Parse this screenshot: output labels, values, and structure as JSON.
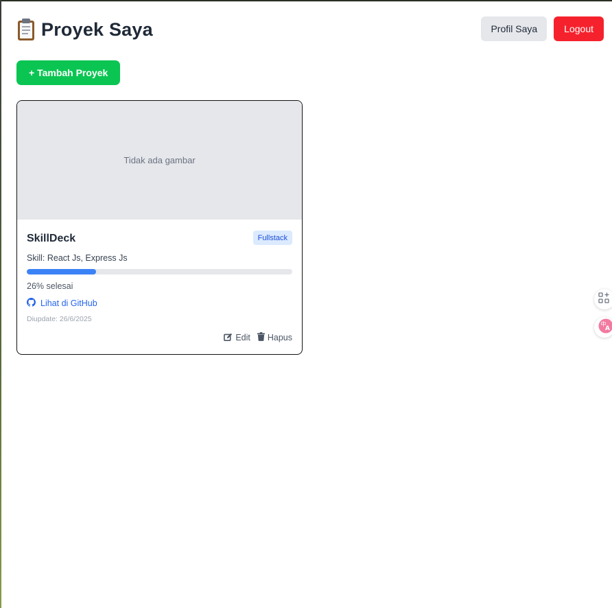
{
  "header": {
    "title": "Proyek Saya",
    "profile_label": "Profil Saya",
    "logout_label": "Logout"
  },
  "toolbar": {
    "add_label": "+ Tambah Proyek"
  },
  "projects": [
    {
      "image_placeholder": "Tidak ada gambar",
      "name": "SkillDeck",
      "category": "Fullstack",
      "skills": "Skill: React Js, Express Js",
      "progress": 26,
      "progress_text": "26% selesai",
      "github_label": "Lihat di GitHub",
      "updated": "Diupdate: 26/6/2025",
      "edit_label": "Edit",
      "delete_label": "Hapus"
    }
  ],
  "floating": {
    "icons": [
      "apps-plus-icon",
      "translate-icon"
    ]
  },
  "colors": {
    "primary_green": "#0bc553",
    "logout_red": "#f5222d",
    "progress_blue": "#3b82f6",
    "link_blue": "#2563eb",
    "badge_bg": "#dbeafe"
  }
}
